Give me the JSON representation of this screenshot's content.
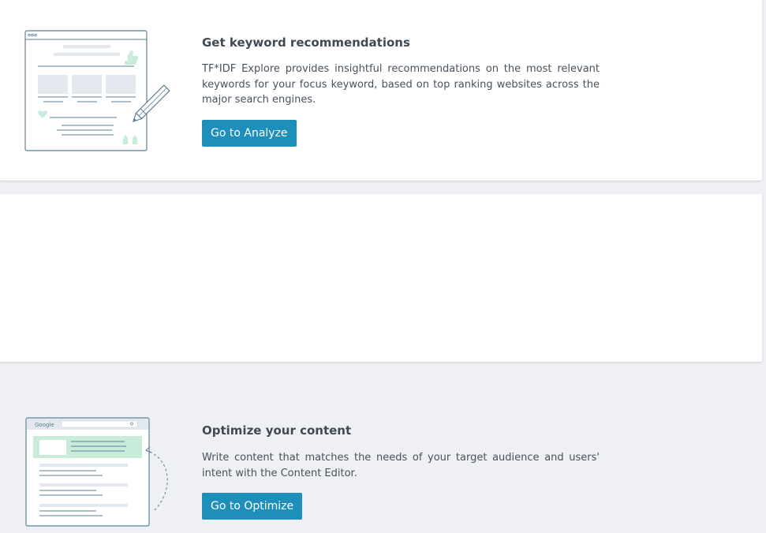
{
  "cards": [
    {
      "title": "Get keyword recommendations",
      "description": "TF*IDF Explore provides insightful recommendations on the most relevant keywords for your focus keyword, based on top ranking websites across the major search engines.",
      "button_label": "Go to Analyze",
      "illustration_icon": "keyword-editor-illustration-icon"
    },
    {
      "title": "Optimize your content",
      "description": "Write content that matches the needs of your target audience and users' intent with the Content Editor.",
      "button_label": "Go to Optimize",
      "illustration_icon": "search-results-illustration-icon",
      "illustration_logo_text": "Google"
    }
  ],
  "colors": {
    "accent": "#1d8fba",
    "illustration_stroke": "#5b8196",
    "illustration_fill": "#e3e8ee",
    "illustration_green": "#c8ecd9"
  }
}
